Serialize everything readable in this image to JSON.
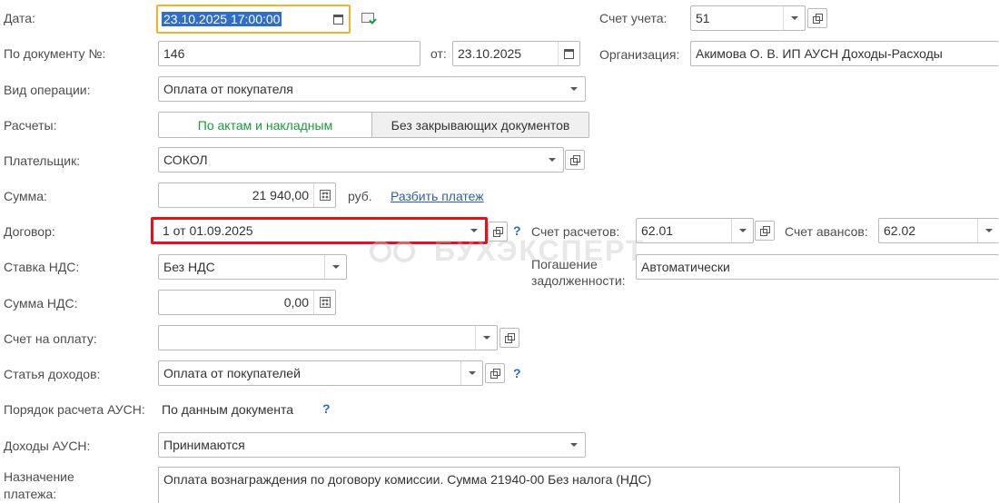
{
  "labels": {
    "date": "Дата:",
    "doc_no": "По документу №:",
    "from": "от:",
    "operation": "Вид операции:",
    "settlements": "Расчеты:",
    "payer": "Плательщик:",
    "amount": "Сумма:",
    "currency": "руб.",
    "contract": "Договор:",
    "vat_rate": "Ставка НДС:",
    "vat_amount": "Сумма НДС:",
    "invoice": "Счет на оплату:",
    "income_item": "Статья доходов:",
    "ausn_order": "Порядок расчета АУСН:",
    "ausn_income": "Доходы АУСН:",
    "purpose_line1": "Назначение",
    "purpose_line2": "платежа:",
    "account": "Счет учета:",
    "organization": "Организация:",
    "settle_account": "Счет расчетов:",
    "advance_account": "Счет авансов:",
    "repayment_line1": "Погашение",
    "repayment_line2": "задолженности:"
  },
  "values": {
    "date": "23.10.2025 17:00:00",
    "doc_no": "146",
    "doc_date": "23.10.2025",
    "operation": "Оплата от покупателя",
    "payer": "СОКОЛ",
    "amount": "21 940,00",
    "contract": "1 от 01.09.2025",
    "vat_rate": "Без НДС",
    "vat_amount": "0,00",
    "invoice": "",
    "income_item": "Оплата от покупателей",
    "ausn_order": "По данным документа",
    "ausn_income": "Принимаются",
    "purpose": "Оплата вознаграждения по договору комиссии. Сумма 21940-00 Без налога (НДС)",
    "account": "51",
    "organization": "Акимова О. В. ИП АУСН Доходы-Расходы",
    "settle_account": "62.01",
    "advance_account": "62.02",
    "repayment": "Автоматически"
  },
  "settlement_options": {
    "by_acts": "По актам и накладным",
    "no_docs": "Без закрывающих документов"
  },
  "links": {
    "split_payment": "Разбить платеж"
  },
  "help": "?",
  "watermark": "БУХЭКСПЕРТ",
  "colors": {
    "accent_green": "#1a9a3a",
    "highlight_red": "#e0141e",
    "focus_yellow": "#f0b429",
    "link_blue": "#2a5fb0"
  }
}
